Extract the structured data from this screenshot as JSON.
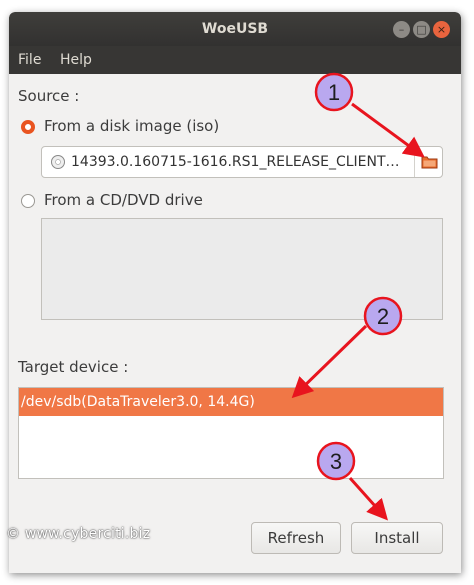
{
  "window": {
    "title": "WoeUSB",
    "controls": {
      "minimize": "–",
      "maximize": "□",
      "close": "×"
    }
  },
  "menu": {
    "items": [
      {
        "label": "File"
      },
      {
        "label": "Help"
      }
    ]
  },
  "source": {
    "label": "Source :",
    "disk_image_option": {
      "label": "From a disk image (iso)",
      "selected": true
    },
    "iso_path": "14393.0.160715-1616.RS1_RELEASE_CLIENT…",
    "cd_dvd_option": {
      "label": "From a CD/DVD drive",
      "selected": false
    }
  },
  "target": {
    "label": "Target device :",
    "devices": [
      {
        "label": "/dev/sdb(DataTraveler3.0, 14.4G)",
        "selected": true
      }
    ]
  },
  "buttons": {
    "refresh": "Refresh",
    "install": "Install"
  },
  "watermark": "© www.cyberciti.biz",
  "callouts": [
    {
      "label": "1"
    },
    {
      "label": "2"
    },
    {
      "label": "3"
    }
  ],
  "colors": {
    "accent": "#e95420",
    "selection": "#f07746",
    "callout_fill": "#b9a8ef",
    "callout_stroke": "#e8141e"
  }
}
